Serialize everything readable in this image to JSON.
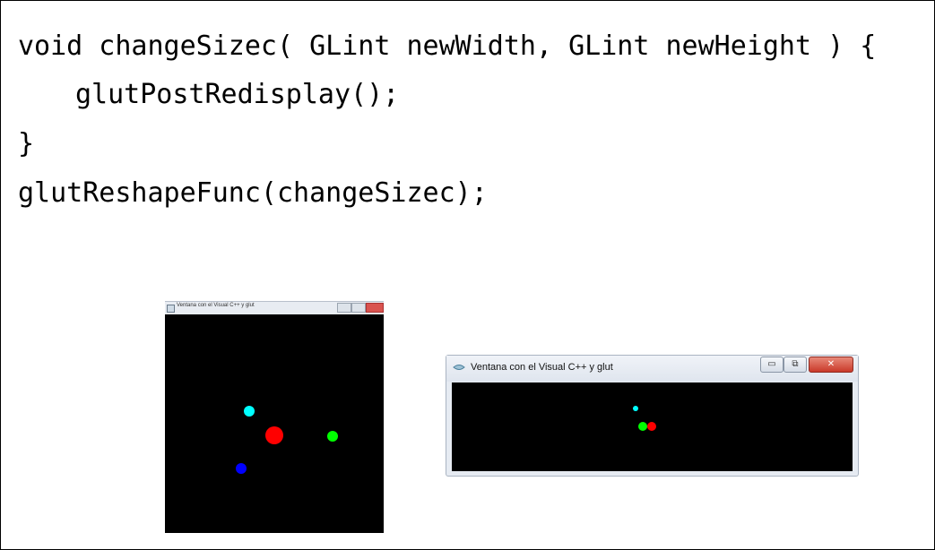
{
  "code": {
    "line1": "void changeSizec( GLint newWidth, GLint newHeight ) {",
    "line2": "glutPostRedisplay();",
    "line3": "}",
    "line4": "glutReshapeFunc(changeSizec);"
  },
  "window_square": {
    "title": "Ventana con el Visual C++ y glut",
    "controls": [
      "minimize",
      "maximize",
      "close"
    ],
    "dot_colors": {
      "cyan": "#00ffff",
      "red": "#ff0000",
      "green": "#00ff00",
      "blue": "#0000ff"
    }
  },
  "window_wide": {
    "title": "Ventana con el Visual C++ y glut",
    "title_icon": "glut-window-icon",
    "min_label": "▭",
    "max_label": "⧉",
    "close_label": "✕",
    "dot_colors": {
      "cyan": "#00ffff",
      "green": "#00ff00",
      "red": "#ff0000"
    }
  }
}
